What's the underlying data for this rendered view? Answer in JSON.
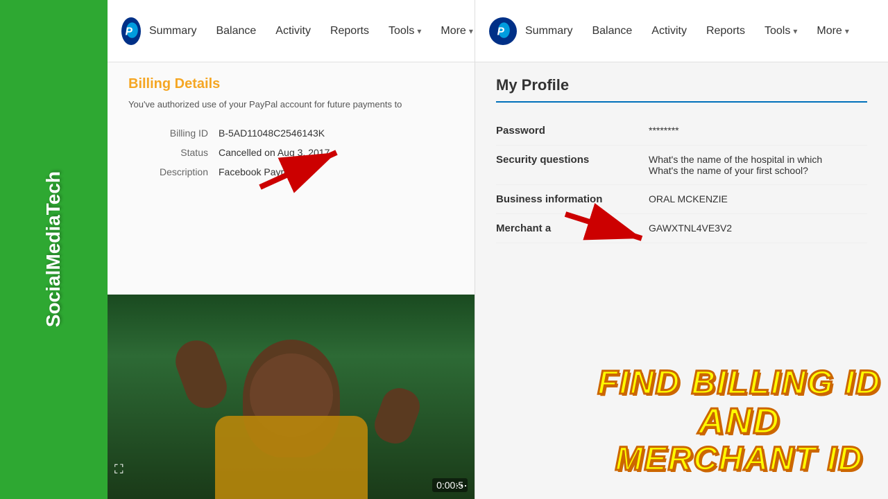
{
  "sidebar": {
    "text": "SocialMediaTech",
    "background_color": "#2ea832"
  },
  "left_panel": {
    "nav": {
      "logo_char": "P",
      "items": [
        {
          "label": "Summary",
          "has_dropdown": false
        },
        {
          "label": "Balance",
          "has_dropdown": false
        },
        {
          "label": "Activity",
          "has_dropdown": false
        },
        {
          "label": "Reports",
          "has_dropdown": false
        },
        {
          "label": "Tools",
          "has_dropdown": true
        },
        {
          "label": "More",
          "has_dropdown": true
        }
      ]
    },
    "billing": {
      "title": "Billing Details",
      "subtitle": "You've authorized use of your PayPal account for future payments to",
      "rows": [
        {
          "label": "Billing ID",
          "value": "B-5AD11048C2546143K"
        },
        {
          "label": "Status",
          "value": "Cancelled on Aug 3, 2017"
        },
        {
          "label": "Description",
          "value": "Facebook Payments"
        }
      ]
    },
    "video": {
      "timestamp": "0:00:5",
      "background": "dark"
    }
  },
  "right_panel": {
    "nav": {
      "logo_char": "P",
      "items": [
        {
          "label": "Summary",
          "has_dropdown": false
        },
        {
          "label": "Balance",
          "has_dropdown": false
        },
        {
          "label": "Activity",
          "has_dropdown": false
        },
        {
          "label": "Reports",
          "has_dropdown": false
        },
        {
          "label": "Tools",
          "has_dropdown": true
        },
        {
          "label": "More",
          "has_dropdown": true
        }
      ]
    },
    "profile": {
      "title": "My Profile",
      "rows": [
        {
          "label": "Password",
          "value": "********"
        },
        {
          "label": "Security questions",
          "value": "What's the name of the hospital in which\nWhat's the name of your first school?"
        },
        {
          "label": "Business information",
          "value": "ORAL MCKENZIE"
        },
        {
          "label": "Merchant a",
          "value": "GAWXTNL4VE3V2"
        }
      ]
    }
  },
  "overlay_text": {
    "line1": "FIND BILLING ID",
    "line2": "AND",
    "line3": "MERCHANT ID"
  }
}
